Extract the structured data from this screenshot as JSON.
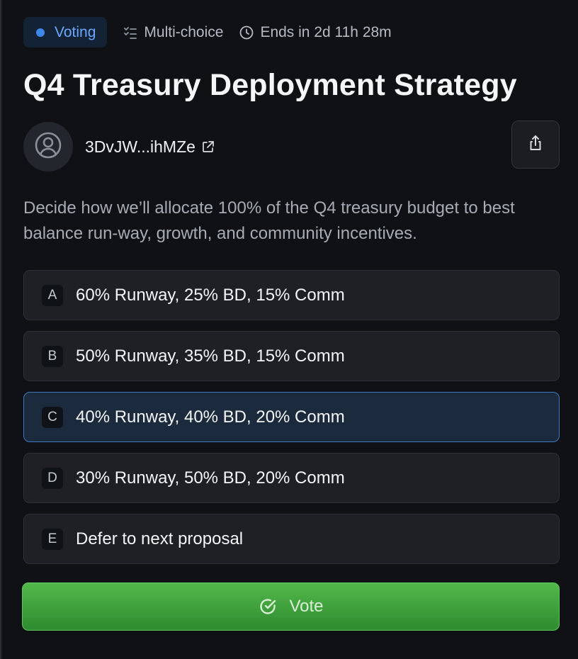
{
  "header": {
    "status": "Voting",
    "type": "Multi-choice",
    "deadline": "Ends in 2d 11h 28m",
    "accent_color": "#3d86ea"
  },
  "proposal": {
    "title": "Q4 Treasury Deployment Strategy",
    "author": "3DvJW...ihMZe",
    "description": "Decide how we’ll allocate 100% of the Q4 treasury budget to best balance run-way, growth, and community incentives."
  },
  "options": [
    {
      "letter": "A",
      "label": "60% Runway, 25% BD, 15% Comm",
      "selected": false
    },
    {
      "letter": "B",
      "label": "50% Runway, 35% BD, 15% Comm",
      "selected": false
    },
    {
      "letter": "C",
      "label": "40% Runway, 40% BD, 20% Comm",
      "selected": true
    },
    {
      "letter": "D",
      "label": "30% Runway, 50% BD, 20% Comm",
      "selected": false
    },
    {
      "letter": "E",
      "label": "Defer to next proposal",
      "selected": false
    }
  ],
  "actions": {
    "vote_label": "Vote",
    "vote_color": "#3fa23c"
  },
  "icons": {
    "type": "checklist-icon",
    "deadline": "clock-icon",
    "avatar": "user-icon",
    "author_link": "external-link-icon",
    "share": "share-icon",
    "vote": "check-circle-icon"
  }
}
